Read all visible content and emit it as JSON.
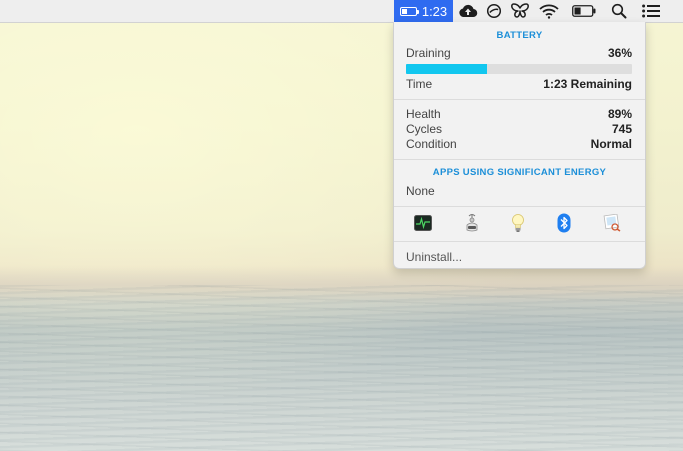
{
  "menubar": {
    "battery_time": "1:23",
    "battery_level": 0.36,
    "icons": [
      "cloud-upload-icon",
      "do-not-disturb-icon",
      "butterfly-icon",
      "wifi-icon",
      "battery-icon",
      "spotlight-search-icon",
      "notification-center-icon"
    ]
  },
  "battery_menu": {
    "title": "BATTERY",
    "draining_label": "Draining",
    "draining_value": "36%",
    "progress": 0.36,
    "time_label": "Time",
    "time_value": "1:23 Remaining",
    "health_label": "Health",
    "health_value": "89%",
    "cycles_label": "Cycles",
    "cycles_value": "745",
    "condition_label": "Condition",
    "condition_value": "Normal",
    "apps_title": "APPS USING SIGNIFICANT ENERGY",
    "apps_value": "None",
    "tool_icons": [
      "activity-monitor-icon",
      "energy-saver-icon",
      "lightbulb-icon",
      "bluetooth-icon",
      "preview-icon"
    ],
    "uninstall_label": "Uninstall..."
  },
  "colors": {
    "accent": "#1c8fd8",
    "progress_fill": "#12c7ef",
    "menubar_highlight": "#2f6bf0"
  }
}
